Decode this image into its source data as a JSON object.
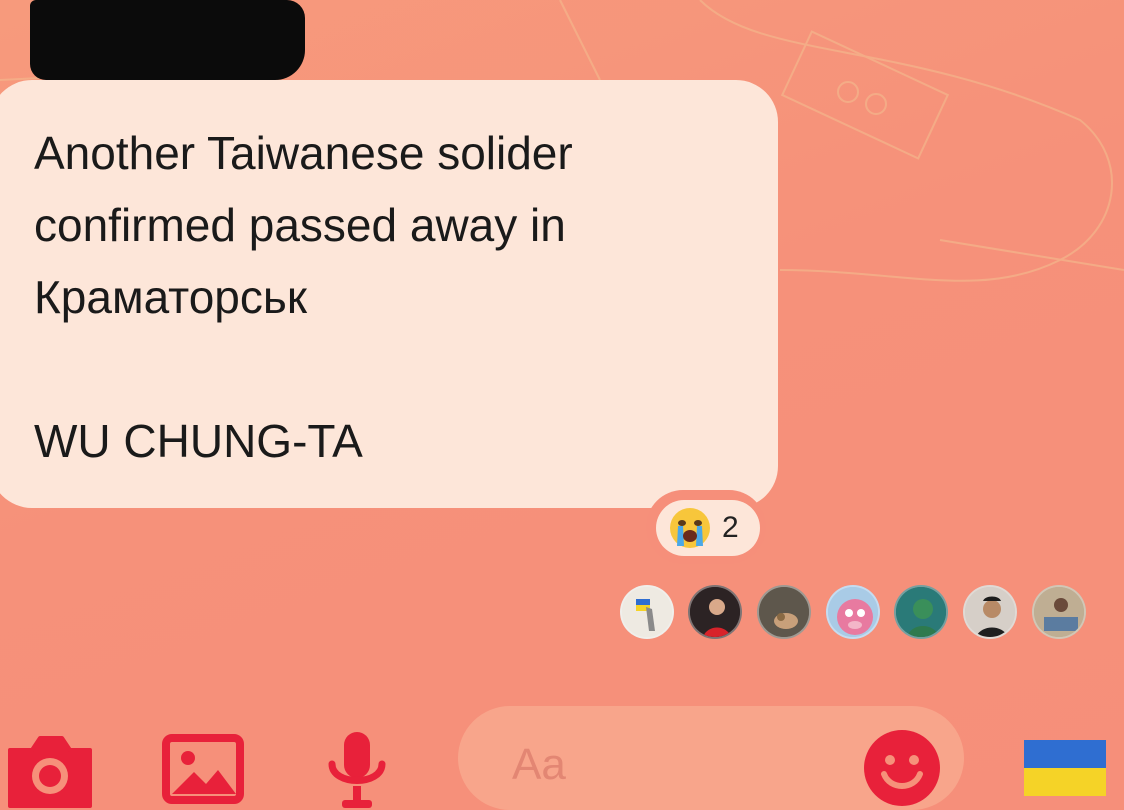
{
  "colors": {
    "background": "#f6917a",
    "bubble": "#fde6d9",
    "accent_red": "#e8213a",
    "flag_blue": "#2f6ed1",
    "flag_yellow": "#f5d327"
  },
  "message": {
    "lines": [
      "Another Taiwanese solider",
      "confirmed passed away in",
      "Краматорськ",
      "",
      "WU CHUNG-TA"
    ]
  },
  "reaction": {
    "icon": "crying-face-emoji",
    "count": "2"
  },
  "seen_by": [
    {
      "icon": "avatar-ukraine-statue"
    },
    {
      "icon": "avatar-woman-red"
    },
    {
      "icon": "avatar-person-hand"
    },
    {
      "icon": "avatar-pink-cartoon"
    },
    {
      "icon": "avatar-green-figure"
    },
    {
      "icon": "avatar-man-dark"
    },
    {
      "icon": "avatar-group-photo"
    }
  ],
  "composer": {
    "camera_icon": "camera-icon",
    "gallery_icon": "image-icon",
    "mic_icon": "microphone-icon",
    "placeholder": "Aa",
    "emoji_icon": "smiley-icon",
    "quick_reaction_icon": "ukraine-flag-icon"
  }
}
